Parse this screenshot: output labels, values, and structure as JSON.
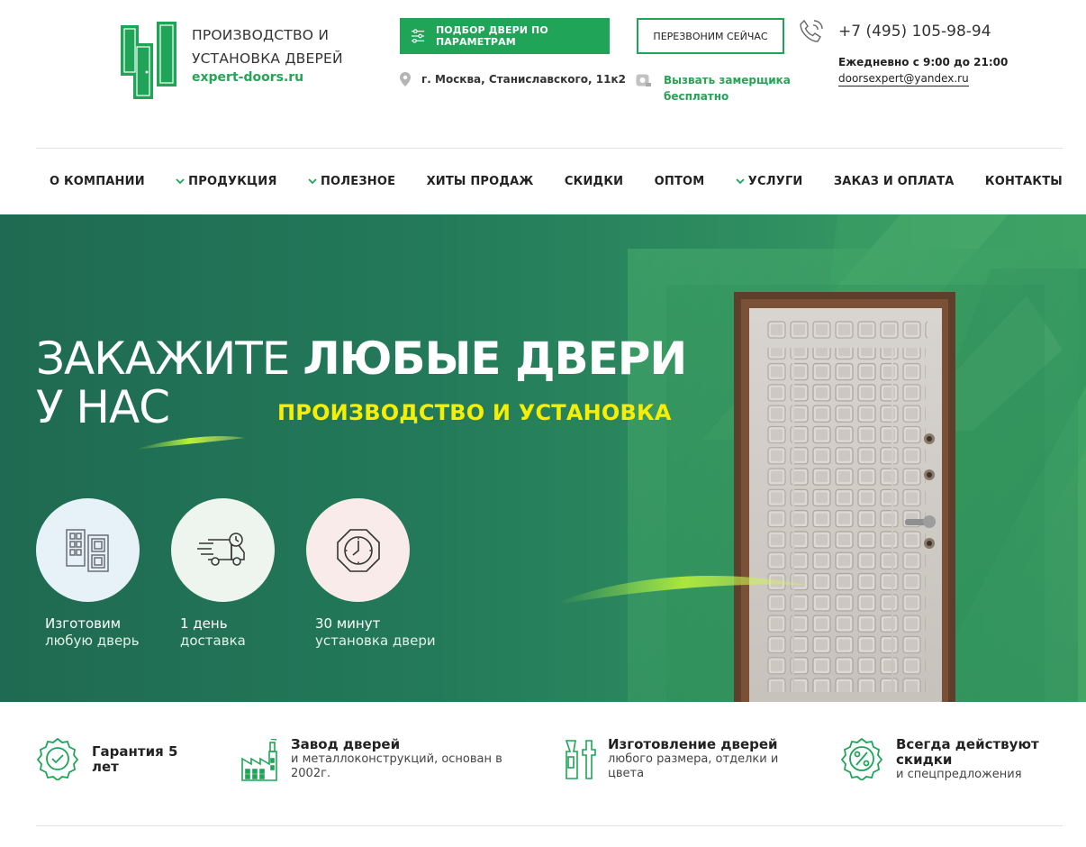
{
  "brand": {
    "title": "ПРОИЗВОДСТВО И УСТАНОВКА ДВЕРЕЙ",
    "site": "expert-doors.ru"
  },
  "header": {
    "pick_door_button": "ПОДБОР ДВЕРИ ПО ПАРАМЕТРАМ",
    "callback_button": "ПЕРЕЗВОНИМ СЕЙЧАС",
    "address": "г. Москва, Станиславского, 11к2",
    "measurer": "Вызвать замерщика бесплатно",
    "phone": "+7 (495) 105-98-94",
    "hours": "Ежедневно с 9:00 до 21:00",
    "email": "doorsexpert@yandex.ru"
  },
  "nav": [
    {
      "label": "О КОМПАНИИ",
      "dropdown": false
    },
    {
      "label": "ПРОДУКЦИЯ",
      "dropdown": true
    },
    {
      "label": "ПОЛЕЗНОЕ",
      "dropdown": true
    },
    {
      "label": "ХИТЫ ПРОДАЖ",
      "dropdown": false
    },
    {
      "label": "СКИДКИ",
      "dropdown": false
    },
    {
      "label": "ОПТОМ",
      "dropdown": false
    },
    {
      "label": "УСЛУГИ",
      "dropdown": true
    },
    {
      "label": "ЗАКАЗ И ОПЛАТА",
      "dropdown": false
    },
    {
      "label": "КОНТАКТЫ",
      "dropdown": false
    }
  ],
  "hero": {
    "title_light": "ЗАКАЖИТЕ",
    "title_bold": "ЛЮБЫЕ ДВЕРИ",
    "title_line2": "У НАС",
    "subtitle": "ПРОИЗВОДСТВО И УСТАНОВКА",
    "features": [
      {
        "line1": "Изготовим",
        "line2": "любую дверь",
        "icon": "doors-icon"
      },
      {
        "line1": "1 день",
        "line2": "доставка",
        "icon": "delivery-truck-icon"
      },
      {
        "line1": "30 минут",
        "line2": "установка двери",
        "icon": "clock-icon"
      }
    ]
  },
  "benefits": [
    {
      "title": "Гарантия 5 лет",
      "desc": "",
      "icon": "guarantee-badge-icon"
    },
    {
      "title": "Завод дверей",
      "desc": "и металлоконструкций, основан в 2002г.",
      "icon": "factory-icon"
    },
    {
      "title": "Изготовление дверей",
      "desc": "любого размера, отделки и цвета",
      "icon": "tools-icon"
    },
    {
      "title": "Всегда действуют скидки",
      "desc": "и спецпредложения",
      "icon": "discount-badge-icon"
    }
  ],
  "colors": {
    "accent": "#1fa458",
    "hero_subtitle": "#f6f000"
  }
}
